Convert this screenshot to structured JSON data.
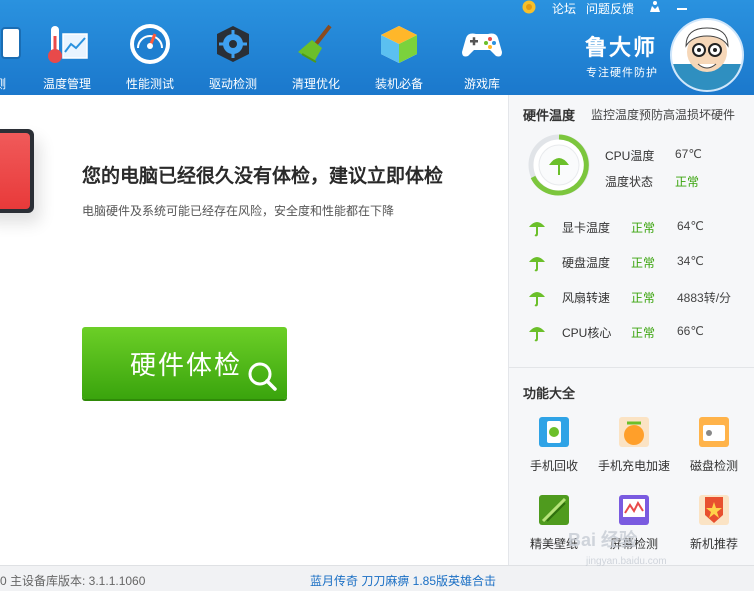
{
  "nav": {
    "items": [
      {
        "label": "测"
      },
      {
        "label": "温度管理"
      },
      {
        "label": "性能测试"
      },
      {
        "label": "驱动检测"
      },
      {
        "label": "清理优化"
      },
      {
        "label": "装机必备"
      },
      {
        "label": "游戏库"
      }
    ]
  },
  "top_links": {
    "forum": "论坛",
    "feedback": "问题反馈"
  },
  "brand": {
    "title": "鲁大师",
    "subtitle": "专注硬件防护"
  },
  "main": {
    "headline": "您的电脑已经很久没有体检，建议立即体检",
    "subline": "电脑硬件及系统可能已经存在风险，安全度和性能都在下降",
    "check_button": "硬件体检"
  },
  "side": {
    "temp_section": {
      "title": "硬件温度",
      "note": "监控温度预防高温损坏硬件",
      "cpu_temp_label": "CPU温度",
      "cpu_temp_value": "67℃",
      "status_label": "温度状态",
      "status_value": "正常"
    },
    "sensors": [
      {
        "name": "显卡温度",
        "status": "正常",
        "value": "64℃"
      },
      {
        "name": "硬盘温度",
        "status": "正常",
        "value": "34℃"
      },
      {
        "name": "风扇转速",
        "status": "正常",
        "value": "4883转/分"
      },
      {
        "name": "CPU核心",
        "status": "正常",
        "value": "66℃"
      }
    ],
    "tools_section": {
      "title": "功能大全",
      "tools": [
        {
          "label": "手机回收"
        },
        {
          "label": "手机充电加速"
        },
        {
          "label": "磁盘检测"
        },
        {
          "label": "精美壁纸"
        },
        {
          "label": "屏幕检测"
        },
        {
          "label": "新机推荐"
        }
      ]
    }
  },
  "status_bar": {
    "version": "0   主设备库版本: 3.1.1.1060",
    "ad": "蓝月传奇 刀刀麻痹 1.85版英雄合击"
  },
  "watermark": {
    "line1": "Bai 经验",
    "line2": "jingyan.baidu.com"
  },
  "colors": {
    "topbar": "#1f82d4",
    "accent_green": "#3aa40d",
    "link_blue": "#1a6fc4"
  }
}
